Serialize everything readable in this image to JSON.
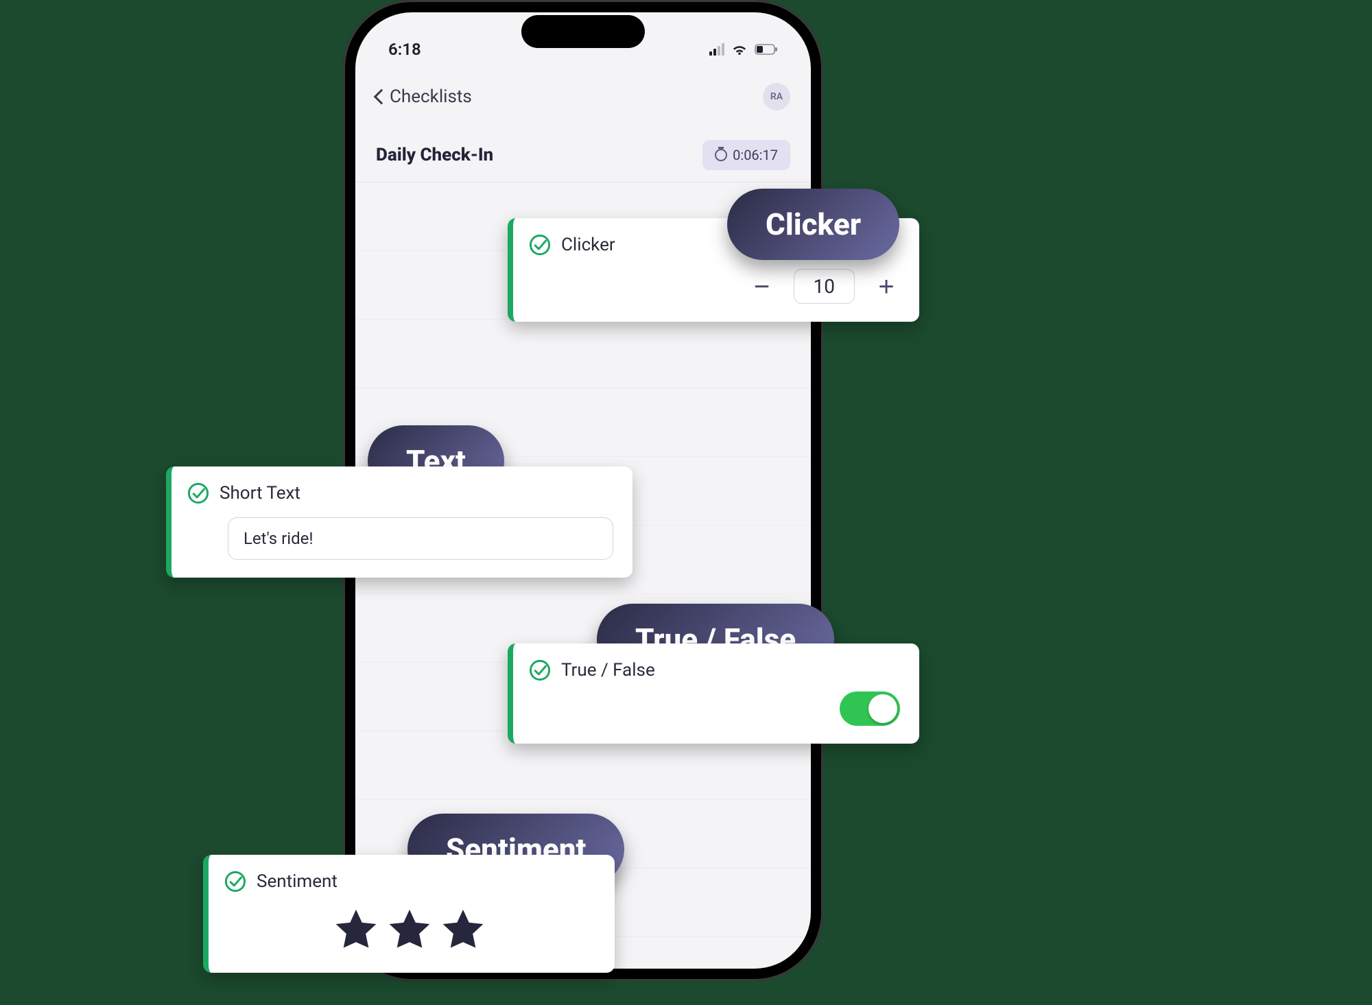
{
  "status_bar": {
    "time": "6:18"
  },
  "nav": {
    "back_label": "Checklists",
    "avatar_initials": "RA"
  },
  "header": {
    "title": "Daily Check-In",
    "timer": "0:06:17"
  },
  "pills": {
    "clicker": "Clicker",
    "text": "Text",
    "truefalse": "True / False",
    "sentiment": "Sentiment"
  },
  "cards": {
    "clicker": {
      "label": "Clicker",
      "value": "10"
    },
    "text": {
      "label": "Short Text",
      "value": "Let's ride!"
    },
    "truefalse": {
      "label": "True / False",
      "on": true
    },
    "sentiment": {
      "label": "Sentiment",
      "stars": 3
    }
  }
}
